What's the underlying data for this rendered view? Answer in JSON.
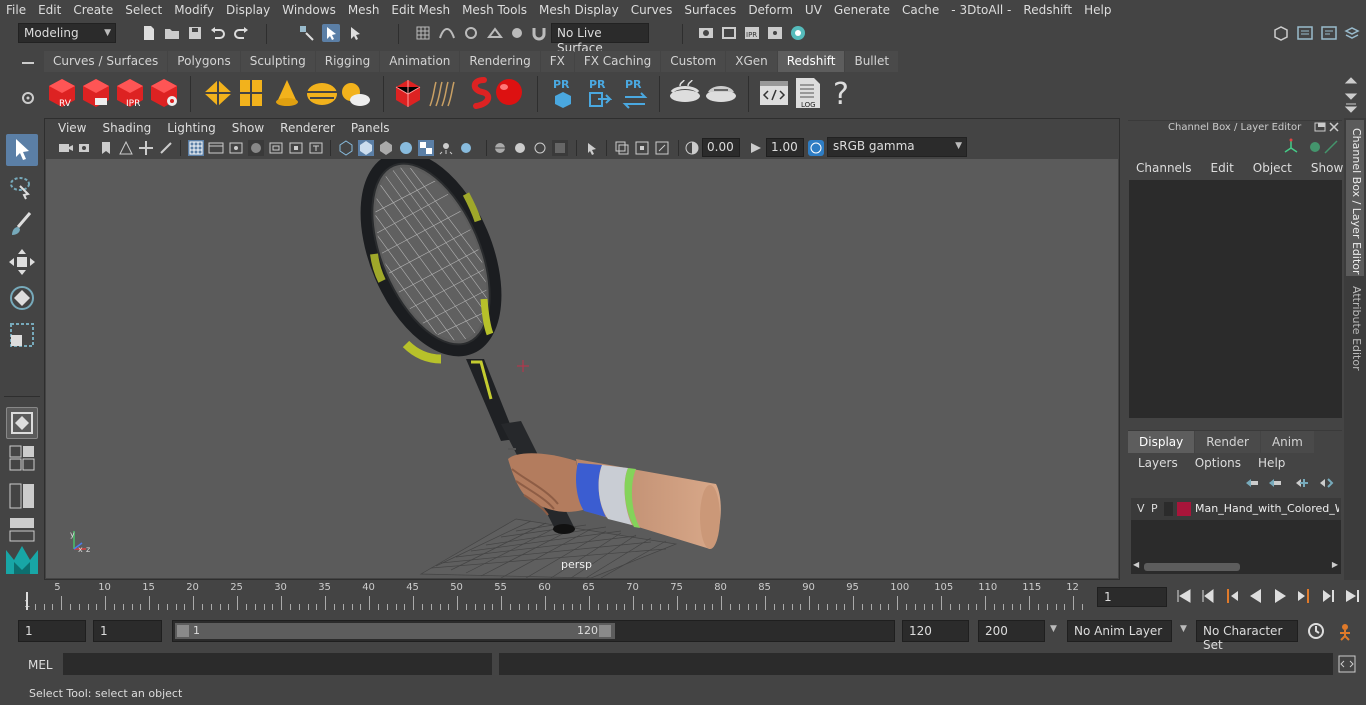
{
  "menubar": {
    "items": [
      "File",
      "Edit",
      "Create",
      "Select",
      "Modify",
      "Display",
      "Windows",
      "Mesh",
      "Edit Mesh",
      "Mesh Tools",
      "Mesh Display",
      "Curves",
      "Surfaces",
      "Deform",
      "UV",
      "Generate",
      "Cache",
      "- 3DtoAll -",
      "Redshift",
      "Help"
    ]
  },
  "statusline": {
    "mode": "Modeling",
    "live_surface": "No Live Surface"
  },
  "shelf": {
    "tabs": [
      "Curves / Surfaces",
      "Polygons",
      "Sculpting",
      "Rigging",
      "Animation",
      "Rendering",
      "FX",
      "FX Caching",
      "Custom",
      "XGen",
      "Redshift",
      "Bullet"
    ],
    "active_tab": "Redshift",
    "icons": {
      "rv": "RV",
      "ipr": "IPR",
      "pr": "PR",
      "log": "LOG",
      "help": "?"
    }
  },
  "viewport": {
    "menu": [
      "View",
      "Shading",
      "Lighting",
      "Show",
      "Renderer",
      "Panels"
    ],
    "exposure": "0.00",
    "gamma": "1.00",
    "colorspace": "sRGB gamma",
    "camera_label": "persp",
    "axis": {
      "x": "x",
      "y": "y",
      "z": "z"
    }
  },
  "channelbox": {
    "title": "Channel Box / Layer Editor",
    "menu": [
      "Channels",
      "Edit",
      "Object",
      "Show"
    ]
  },
  "layereditor": {
    "tabs": [
      "Display",
      "Render",
      "Anim"
    ],
    "active_tab": "Display",
    "menu": [
      "Layers",
      "Options",
      "Help"
    ],
    "layer": {
      "v": "V",
      "p": "P",
      "name": "Man_Hand_with_Colored_W",
      "color": "#a8153a"
    }
  },
  "sidetabs": [
    "Channel Box / Layer Editor",
    "Attribute Editor"
  ],
  "timeline": {
    "ticks": [
      "5",
      "10",
      "15",
      "20",
      "25",
      "30",
      "35",
      "40",
      "45",
      "50",
      "55",
      "60",
      "65",
      "70",
      "75",
      "80",
      "85",
      "90",
      "95",
      "100",
      "105",
      "110",
      "115",
      "12"
    ],
    "start_label": "1",
    "current_frame": "1"
  },
  "range": {
    "start": "1",
    "playback_start": "1",
    "slider_start": "1",
    "slider_end": "120",
    "playback_end": "120",
    "end": "200",
    "anim_layer": "No Anim Layer",
    "character_set": "No Character Set"
  },
  "cmdline": {
    "lang": "MEL"
  },
  "helpline": {
    "text": "Select Tool: select an object"
  }
}
